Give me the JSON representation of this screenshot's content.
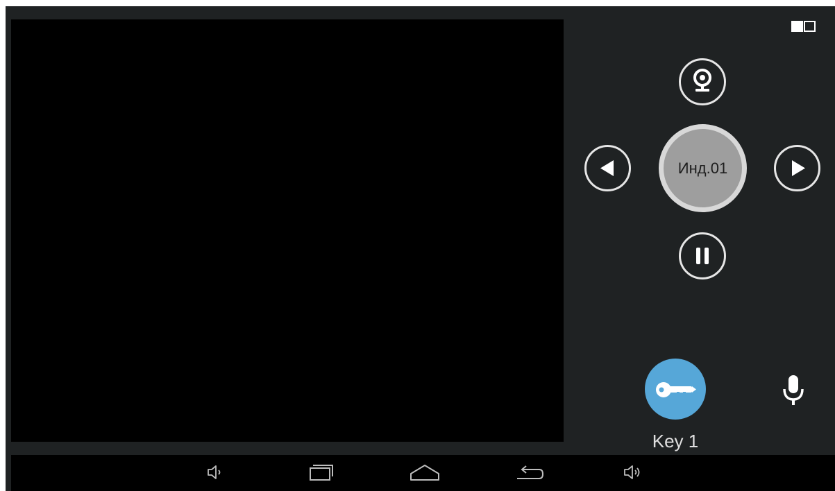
{
  "video": {
    "content": ""
  },
  "controls": {
    "channel_label": "Инд.01",
    "key_label": "Key 1"
  },
  "icons": {
    "panel_toggle": "book-icon",
    "camera": "webcam-icon",
    "previous": "triangle-left-icon",
    "next": "triangle-right-icon",
    "pause": "pause-icon",
    "key": "key-icon",
    "mic": "microphone-icon",
    "volume_down": "volume-down-icon",
    "recent_apps": "recent-apps-icon",
    "home": "home-icon",
    "back": "back-icon",
    "volume_up": "volume-up-icon"
  },
  "colors": {
    "background": "#1f2223",
    "video": "#000000",
    "key_button": "#56a7d8",
    "channel_button": "#9e9e9e",
    "navbar": "#000000"
  }
}
